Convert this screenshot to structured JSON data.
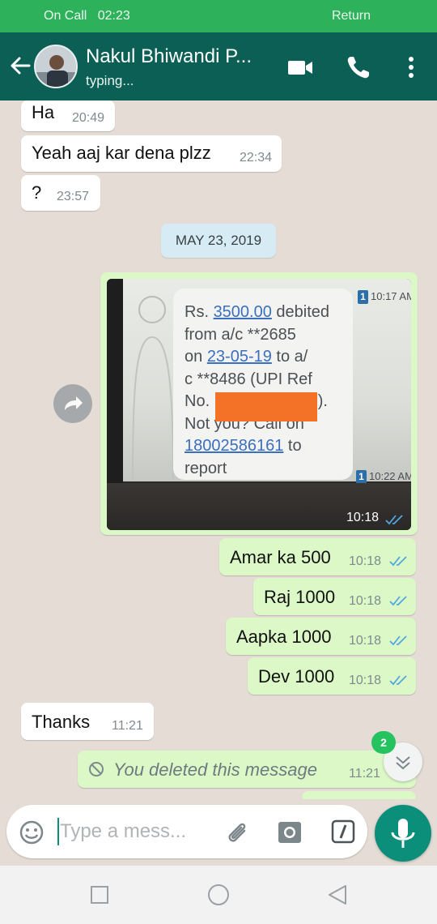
{
  "call_bar": {
    "left_label": "On Call",
    "time": "02:23",
    "right_label": "Return"
  },
  "header": {
    "contact_name": "Nakul Bhiwandi P...",
    "status": "typing...",
    "icons": [
      "back-arrow-icon",
      "video-call-icon",
      "voice-call-icon",
      "more-vert-icon"
    ]
  },
  "messages_before": [
    {
      "dir": "in",
      "text": "Ha",
      "time": "20:49"
    },
    {
      "dir": "in",
      "text": "Yeah aaj kar dena plzz",
      "time": "22:34"
    },
    {
      "dir": "in",
      "text": "?",
      "time": "23:57"
    }
  ],
  "date_chip": "MAY 23, 2019",
  "image_message": {
    "time": "10:18",
    "sms_lines": [
      "Rs. ",
      "3500.00",
      " debited",
      "from a/c **2685",
      "on ",
      "23-05-19",
      " to a/",
      "c **8486 (UPI Ref",
      "No. ",
      ").",
      "Not you? Call on",
      "18002586161",
      " to",
      "report"
    ],
    "sim_time_top": "10:17 AM",
    "sim_time_bottom": "10:22 AM",
    "sim_label": "1"
  },
  "messages_after": [
    {
      "dir": "out",
      "text": "Amar ka 500",
      "time": "10:18"
    },
    {
      "dir": "out",
      "text": "Raj 1000",
      "time": "10:18"
    },
    {
      "dir": "out",
      "text": "Aapka 1000",
      "time": "10:18"
    },
    {
      "dir": "out",
      "text": "Dev 1000",
      "time": "10:18"
    },
    {
      "dir": "in",
      "text": "Thanks",
      "time": "11:21"
    },
    {
      "dir": "out",
      "text": "You deleted this message",
      "time": "11:21"
    }
  ],
  "unread_badge": "2",
  "input": {
    "placeholder": "Type a mess..."
  },
  "colors": {
    "header": "#0b5f54",
    "call_bar": "#2eb15b",
    "out_bubble": "#dcf8c6",
    "in_bubble": "#ffffff",
    "accent": "#0b8e7a",
    "read_ticks": "#4fa8e0"
  }
}
